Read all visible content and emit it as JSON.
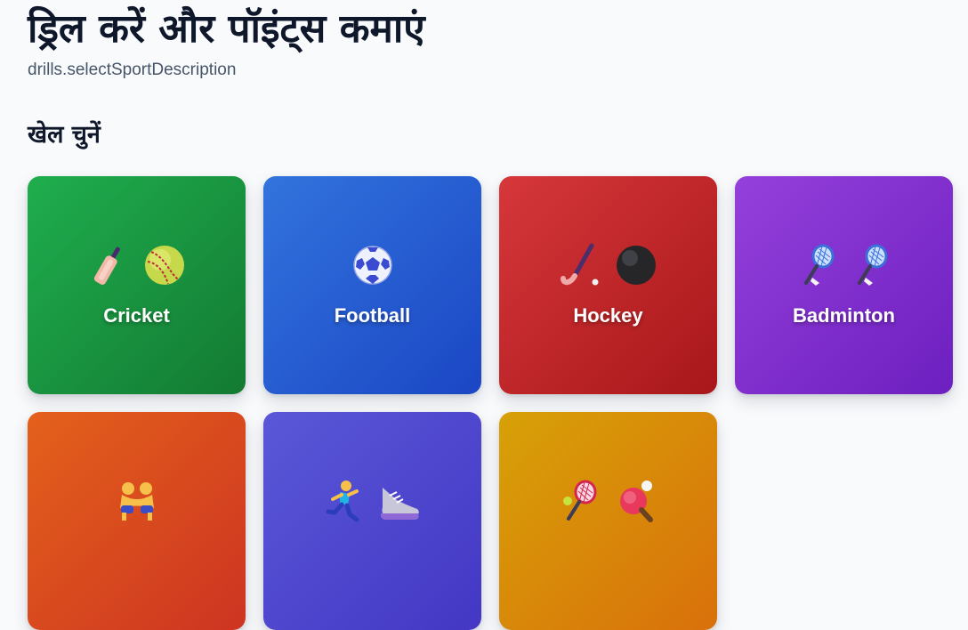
{
  "header": {
    "title": "ड्रिल करें और पॉइंट्स कमाएं",
    "subtitle": "drills.selectSportDescription"
  },
  "section": {
    "title": "खेल चुनें"
  },
  "sports": [
    {
      "label": "Cricket",
      "icons": [
        "cricket-bat-icon",
        "cricket-ball-icon"
      ],
      "colors": [
        "#1fae4e",
        "#137a32"
      ]
    },
    {
      "label": "Football",
      "icons": [
        "soccer-ball-icon"
      ],
      "colors": [
        "#3274dd",
        "#1b46c5"
      ]
    },
    {
      "label": "Hockey",
      "icons": [
        "hockey-stick-icon",
        "hockey-ball-icon"
      ],
      "colors": [
        "#d6373a",
        "#a8171a"
      ]
    },
    {
      "label": "Badminton",
      "icons": [
        "badminton-racket-icon",
        "badminton-racket-icon"
      ],
      "colors": [
        "#9440dc",
        "#6d1fbf"
      ]
    },
    {
      "label": "",
      "icons": [
        "wrestlers-icon"
      ],
      "colors": [
        "#e4611b",
        "#cd3422"
      ]
    },
    {
      "label": "",
      "icons": [
        "runner-icon",
        "running-shoe-icon"
      ],
      "colors": [
        "#5a58d8",
        "#4337c4"
      ]
    },
    {
      "label": "",
      "icons": [
        "tennis-racket-icon",
        "ping-pong-paddle-icon"
      ],
      "colors": [
        "#d7a107",
        "#d9700b"
      ]
    }
  ]
}
